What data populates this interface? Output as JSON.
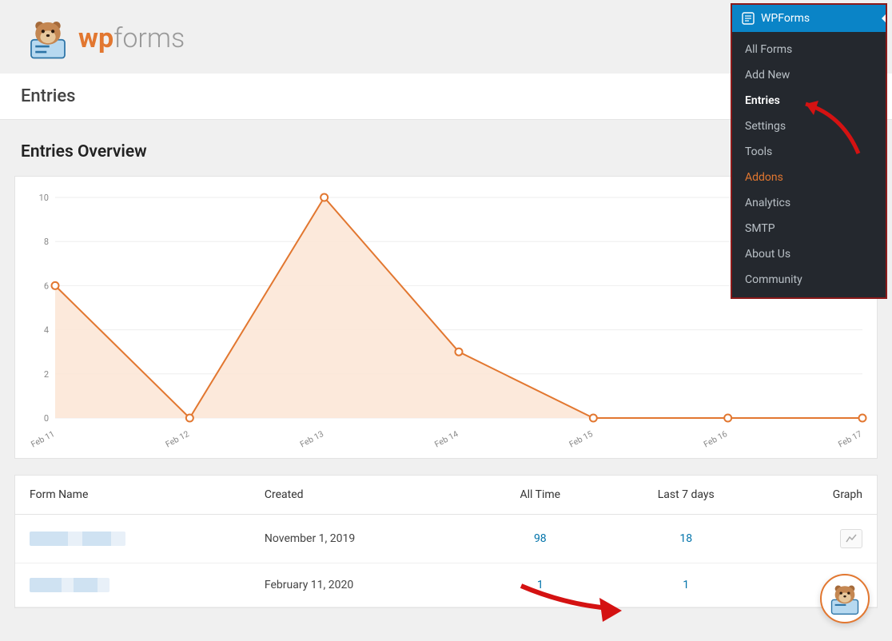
{
  "logo": {
    "prefix": "wp",
    "suffix": "forms"
  },
  "page_title": "Entries",
  "overview_title": "Entries Overview",
  "sidebar": {
    "header": "WPForms",
    "items": [
      {
        "label": "All Forms",
        "active": false
      },
      {
        "label": "Add New",
        "active": false
      },
      {
        "label": "Entries",
        "active": true
      },
      {
        "label": "Settings",
        "active": false
      },
      {
        "label": "Tools",
        "active": false
      },
      {
        "label": "Addons",
        "active": false,
        "accent": true
      },
      {
        "label": "Analytics",
        "active": false
      },
      {
        "label": "SMTP",
        "active": false
      },
      {
        "label": "About Us",
        "active": false
      },
      {
        "label": "Community",
        "active": false
      }
    ]
  },
  "table": {
    "cols": [
      "Form Name",
      "Created",
      "All Time",
      "Last 7 days",
      "Graph"
    ],
    "rows": [
      {
        "created": "November 1, 2019",
        "all_time": "98",
        "last7": "18"
      },
      {
        "created": "February 11, 2020",
        "all_time": "1",
        "last7": "1"
      }
    ]
  },
  "chart_data": {
    "type": "area",
    "categories": [
      "Feb 11",
      "Feb 12",
      "Feb 13",
      "Feb 14",
      "Feb 15",
      "Feb 16",
      "Feb 17"
    ],
    "values": [
      6,
      0,
      10,
      3,
      0,
      0,
      0
    ],
    "ylim": [
      0,
      10
    ],
    "yticks": [
      0,
      2,
      4,
      6,
      8,
      10
    ],
    "color": "#e27730",
    "fill": "#fbe5d5"
  }
}
